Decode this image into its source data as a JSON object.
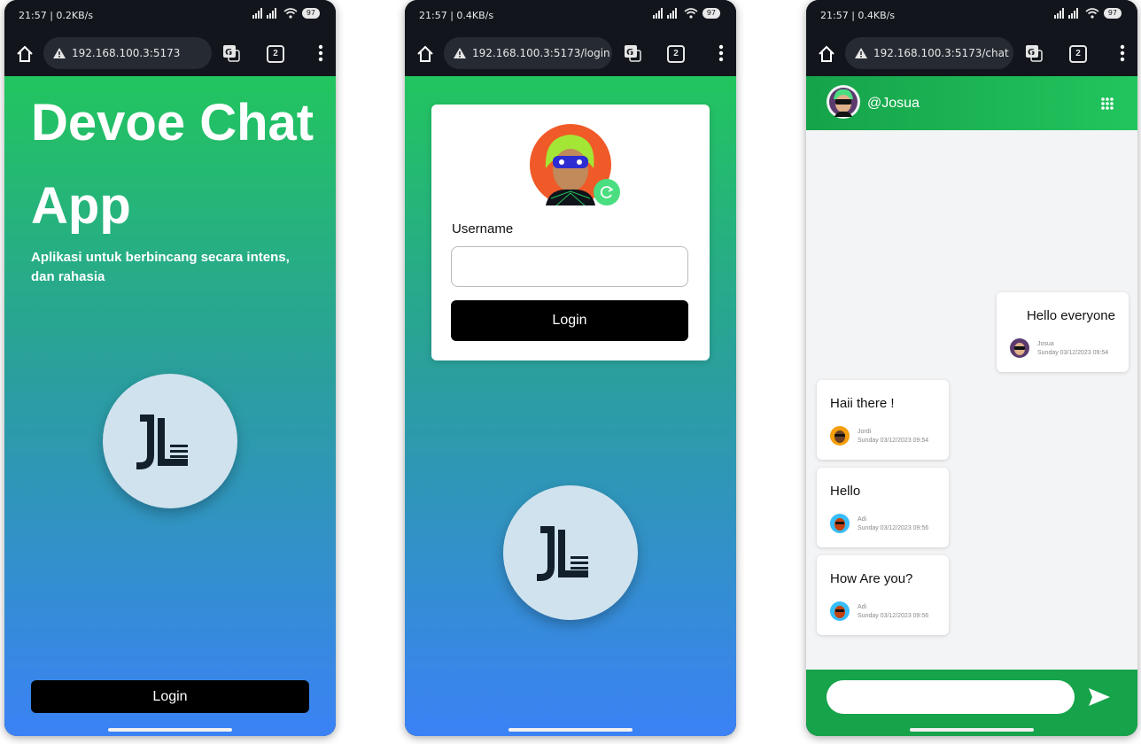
{
  "phones": [
    {
      "status": {
        "time_speed": "21:57 | 0.2KB/s",
        "battery": "97"
      },
      "url": "192.168.100.3:5173",
      "tabs_count": "2",
      "hero": {
        "title": "Devoe Chat App",
        "subtitle": "Aplikasi untuk berbincang secara intens, dan rahasia"
      },
      "login_label": "Login"
    },
    {
      "status": {
        "time_speed": "21:57 | 0.4KB/s",
        "battery": "97"
      },
      "url": "192.168.100.3:5173/login",
      "tabs_count": "2",
      "form": {
        "username_label": "Username",
        "username_value": "",
        "login_label": "Login"
      }
    },
    {
      "status": {
        "time_speed": "21:57 | 0.4KB/s",
        "battery": "97"
      },
      "url": "192.168.100.3:5173/chat",
      "tabs_count": "2",
      "chat": {
        "username": "@Josua",
        "messages": [
          {
            "text": "Hello everyone",
            "sender": "Josua",
            "time": "Sunday 03/12/2023 09:54",
            "own": true
          },
          {
            "text": "Haii there !",
            "sender": "Jordi",
            "time": "Sunday 03/12/2023 09:54",
            "own": false
          },
          {
            "text": "Hello",
            "sender": "Adi",
            "time": "Sunday 03/12/2023 09:56",
            "own": false
          },
          {
            "text": "How Are you?",
            "sender": "Adi",
            "time": "Sunday 03/12/2023 09:56",
            "own": false
          }
        ],
        "input_value": ""
      }
    }
  ],
  "colors": {
    "green": "#22c55e",
    "blue": "#3b82f6",
    "dark_green": "#16a34a",
    "button_black": "#000000",
    "logo_bg": "#cfe2ee"
  },
  "icons": [
    "home-icon",
    "warning-icon",
    "translate-icon",
    "tabs-icon",
    "menu-icon",
    "wifi-icon",
    "signal-icon",
    "alarm-icon",
    "refresh-icon",
    "grid-icon",
    "send-icon",
    "devoe-logo-icon"
  ]
}
